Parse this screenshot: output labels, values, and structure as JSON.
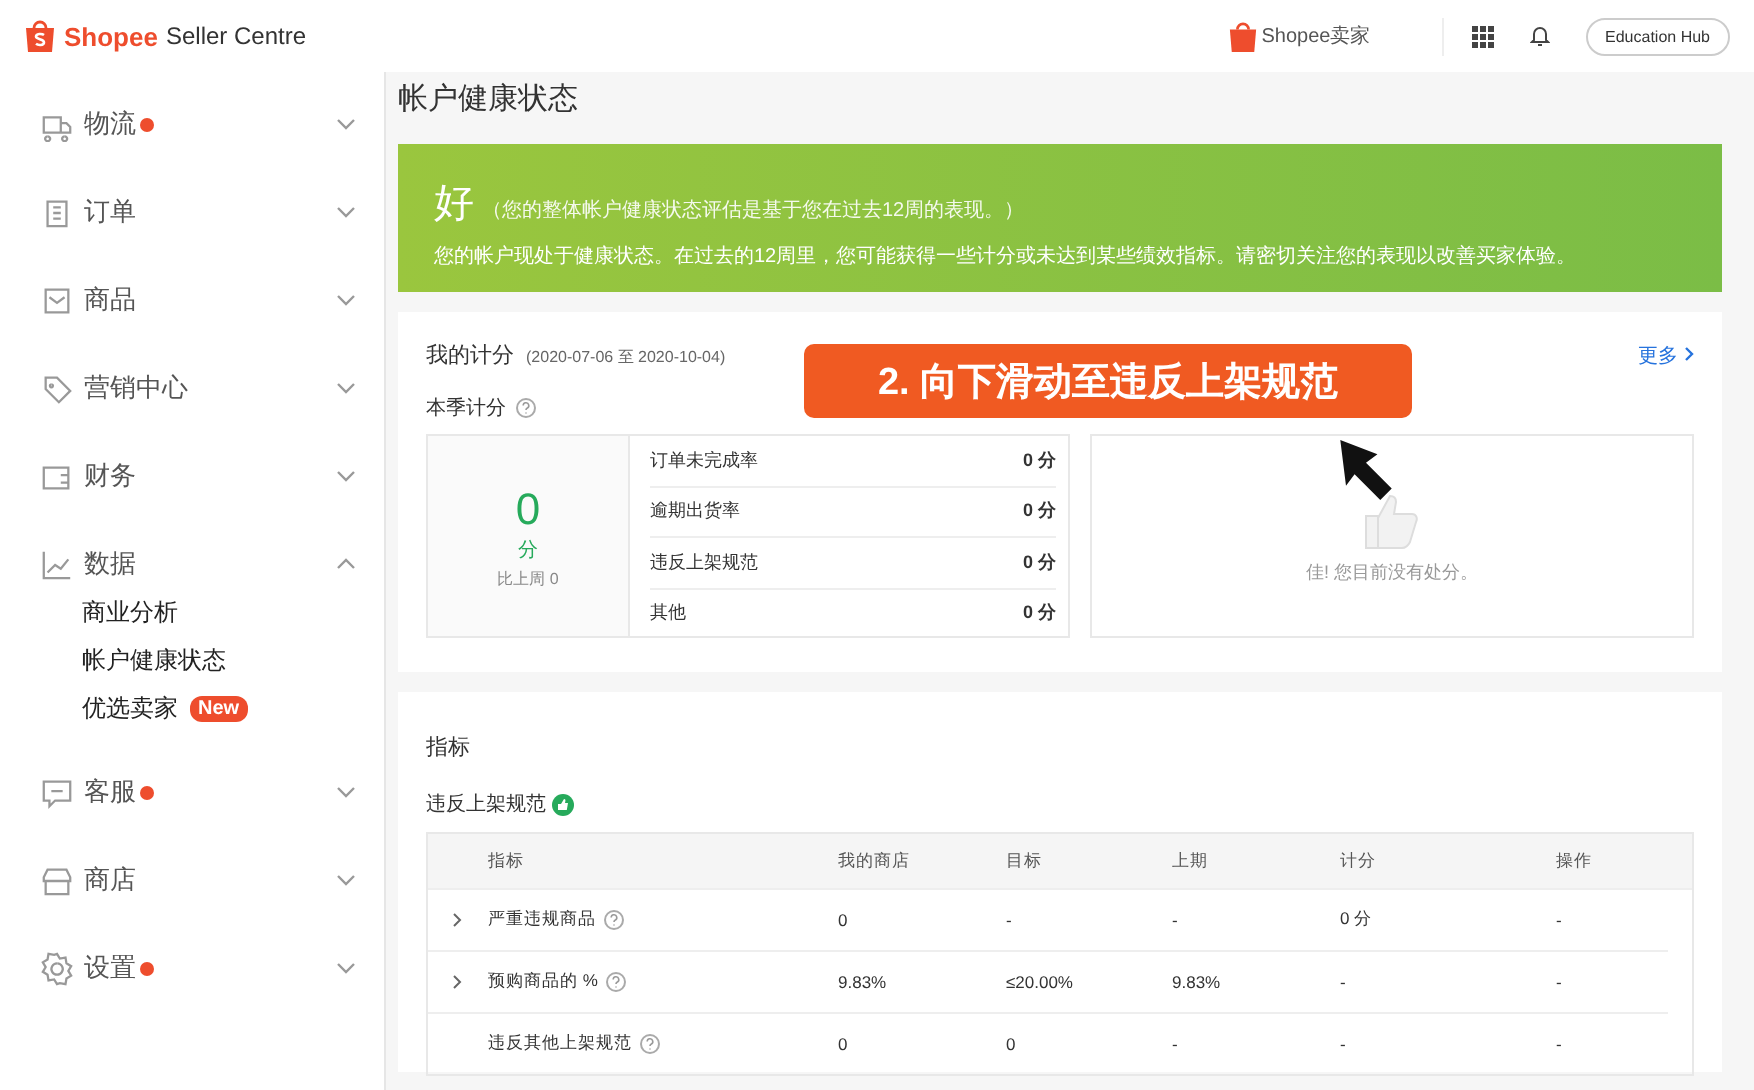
{
  "header": {
    "brand": "Shopee",
    "product": "Seller Centre",
    "center_logo": "Shopee卖家",
    "education_button": "Education Hub"
  },
  "sidebar": {
    "items": [
      {
        "label": "物流",
        "dot": true,
        "expanded": false
      },
      {
        "label": "订单",
        "dot": false,
        "expanded": false
      },
      {
        "label": "商品",
        "dot": false,
        "expanded": false
      },
      {
        "label": "营销中心",
        "dot": false,
        "expanded": false
      },
      {
        "label": "财务",
        "dot": false,
        "expanded": false
      },
      {
        "label": "数据",
        "dot": false,
        "expanded": true,
        "children": [
          {
            "label": "商业分析"
          },
          {
            "label": "帐户健康状态"
          },
          {
            "label": "优选卖家",
            "badge": "New"
          }
        ]
      },
      {
        "label": "客服",
        "dot": true,
        "expanded": false
      },
      {
        "label": "商店",
        "dot": false,
        "expanded": false
      },
      {
        "label": "设置",
        "dot": true,
        "expanded": false
      }
    ]
  },
  "page_title": "帐户健康状态",
  "banner": {
    "status": "好",
    "note": "（您的整体帐户健康状态评估是基于您在过去12周的表现。）",
    "message": "您的帐户现处于健康状态。在过去的12周里，您可能获得一些计分或未达到某些绩效指标。请密切关注您的表现以改善买家体验。"
  },
  "score": {
    "title": "我的计分",
    "period": "(2020-07-06 至 2020-10-04)",
    "more": "更多",
    "quarter_label": "本季计分",
    "total": "0",
    "unit": "分",
    "compare": "比上周 0",
    "rows": [
      {
        "label": "订单未完成率",
        "value": "0 分"
      },
      {
        "label": "逾期出货率",
        "value": "0 分"
      },
      {
        "label": "违反上架规范",
        "value": "0 分"
      },
      {
        "label": "其他",
        "value": "0 分"
      }
    ],
    "empty_message": "佳! 您目前没有处分。"
  },
  "indicators": {
    "title": "指标",
    "section": "违反上架规范",
    "columns": [
      "指标",
      "我的商店",
      "目标",
      "上期",
      "计分",
      "操作"
    ],
    "rows": [
      {
        "expandable": true,
        "cells": [
          "严重违规商品",
          "0",
          "-",
          "-",
          "0 分",
          "-"
        ]
      },
      {
        "expandable": true,
        "cells": [
          "预购商品的 %",
          "9.83%",
          "≤20.00%",
          "9.83%",
          "-",
          "-"
        ]
      },
      {
        "expandable": false,
        "cells": [
          "违反其他上架规范",
          "0",
          "0",
          "-",
          "-",
          "-"
        ]
      }
    ]
  },
  "overlay_caption": "2. 向下滑动至违反上架规范"
}
